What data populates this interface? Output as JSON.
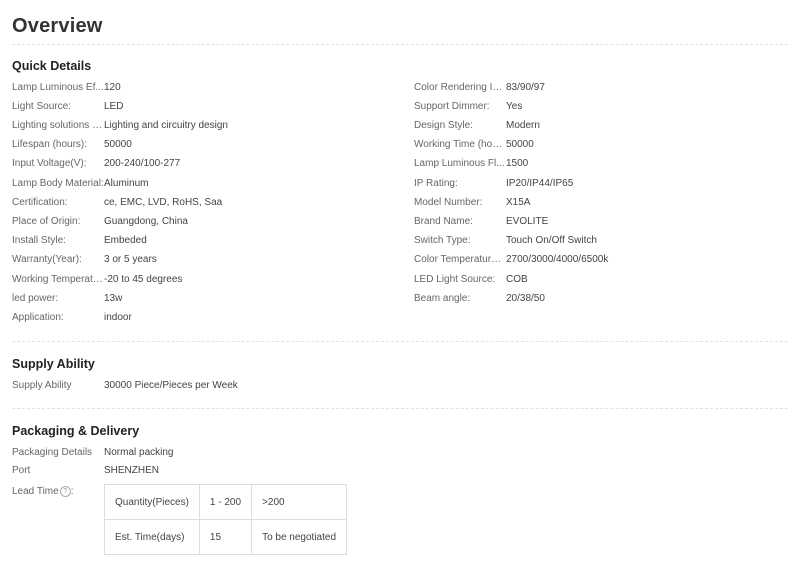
{
  "page_title": "Overview",
  "quick_details": {
    "title": "Quick Details",
    "left": [
      {
        "label": "Lamp Luminous Ef...",
        "value": "120"
      },
      {
        "label": "Light Source:",
        "value": "LED"
      },
      {
        "label": "Lighting solutions s...",
        "value": "Lighting and circuitry design"
      },
      {
        "label": "Lifespan (hours):",
        "value": "50000"
      },
      {
        "label": "Input Voltage(V):",
        "value": "200-240/100-277"
      },
      {
        "label": "Lamp Body Material:",
        "value": "Aluminum"
      },
      {
        "label": "Certification:",
        "value": "ce, EMC, LVD, RoHS, Saa"
      },
      {
        "label": "Place of Origin:",
        "value": "Guangdong, China"
      },
      {
        "label": "Install Style:",
        "value": "Embeded"
      },
      {
        "label": "Warranty(Year):",
        "value": "3 or 5 years"
      },
      {
        "label": "Working Temperatu...",
        "value": "-20 to 45 degrees"
      },
      {
        "label": "led power:",
        "value": "13w"
      },
      {
        "label": "Application:",
        "value": "indoor"
      }
    ],
    "right": [
      {
        "label": "Color Rendering In...",
        "value": "83/90/97"
      },
      {
        "label": "Support Dimmer:",
        "value": "Yes"
      },
      {
        "label": "Design Style:",
        "value": "Modern"
      },
      {
        "label": "Working Time (hou...",
        "value": "50000"
      },
      {
        "label": "Lamp Luminous Fl...",
        "value": "1500"
      },
      {
        "label": "IP Rating:",
        "value": "IP20/IP44/IP65"
      },
      {
        "label": "Model Number:",
        "value": "X15A"
      },
      {
        "label": "Brand Name:",
        "value": "EVOLITE"
      },
      {
        "label": "Switch Type:",
        "value": "Touch On/Off Switch"
      },
      {
        "label": "Color Temperature(...",
        "value": "2700/3000/4000/6500k"
      },
      {
        "label": "LED Light Source:",
        "value": "COB"
      },
      {
        "label": "Beam angle:",
        "value": "20/38/50"
      }
    ]
  },
  "supply_ability": {
    "title": "Supply Ability",
    "label": "Supply Ability",
    "value": "30000 Piece/Pieces per Week"
  },
  "packaging": {
    "title": "Packaging & Delivery",
    "details_label": "Packaging Details",
    "details_value": "Normal packing",
    "port_label": "Port",
    "port_value": "SHENZHEN",
    "lead_time_label": "Lead Time",
    "help_icon": "?",
    "lead_table": {
      "quantity_label": "Quantity(Pieces)",
      "quantity_range1": "1 - 200",
      "quantity_range2": ">200",
      "time_label": "Est. Time(days)",
      "time_value1": "15",
      "time_value2": "To be negotiated"
    }
  }
}
